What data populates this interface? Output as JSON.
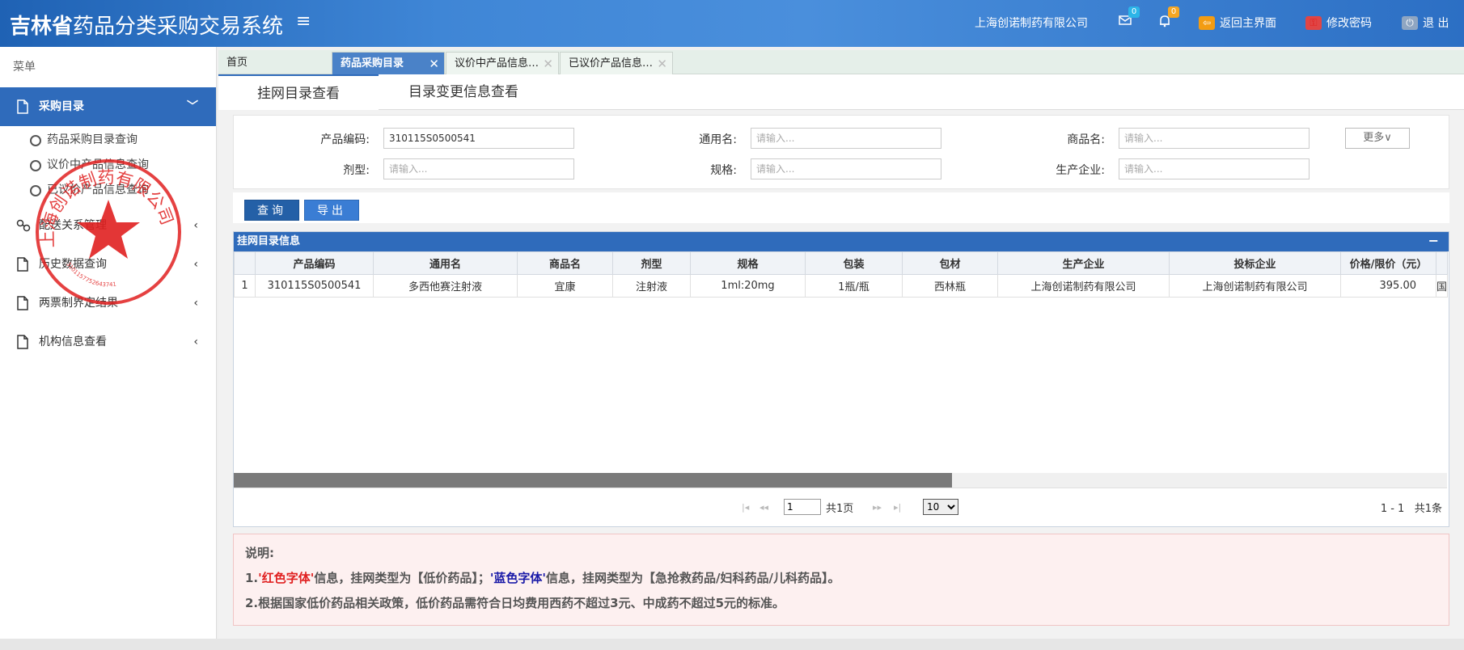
{
  "header": {
    "title_bold": "吉林省",
    "title_rest": "药品分类采购交易系统",
    "company": "上海创诺制药有限公司",
    "mail_count": "0",
    "notice_count": "0",
    "return_label": "返回主界面",
    "password_label": "修改密码",
    "logout_label": "退 出"
  },
  "sidebar": {
    "title": "菜单",
    "active_item": "采购目录",
    "sub_items": [
      "药品采购目录查询",
      "议价中产品信息查询",
      "已议价产品信息查询"
    ],
    "items": [
      "配送关系管理",
      "历史数据查询",
      "两票制界定结果",
      "机构信息查看"
    ]
  },
  "tabs": [
    "首页",
    "药品采购目录",
    "议价中产品信息…",
    "已议价产品信息…"
  ],
  "subtabs": [
    "挂网目录查看",
    "目录变更信息查看"
  ],
  "search": {
    "code_label": "产品编码:",
    "code_value": "310115S0500541",
    "generic_label": "通用名:",
    "trade_label": "商品名:",
    "form_label": "剂型:",
    "spec_label": "规格:",
    "maker_label": "生产企业:",
    "placeholder": "请输入...",
    "more_label": "更多∨"
  },
  "actions": {
    "query": "查询",
    "export": "导出"
  },
  "grid": {
    "title": "挂网目录信息",
    "collapse": "−",
    "columns": [
      "",
      "产品编码",
      "通用名",
      "商品名",
      "剂型",
      "规格",
      "包装",
      "包材",
      "生产企业",
      "投标企业",
      "价格/限价（元）",
      ""
    ],
    "rows": [
      [
        "1",
        "310115S0500541",
        "多西他赛注射液",
        "宜康",
        "注射液",
        "1ml:20mg",
        "1瓶/瓶",
        "西林瓶",
        "上海创诺制药有限公司",
        "上海创诺制药有限公司",
        "395.00",
        "国"
      ]
    ]
  },
  "pager": {
    "page_value": "1",
    "total_pages": "共1页",
    "page_size": "10",
    "summary": "1 - 1   共1条"
  },
  "note": {
    "title": "说明:",
    "line1_prefix": "1.",
    "line1_red": "'红色字体'",
    "line1_mid": "信息，挂网类型为【低价药品】；",
    "line1_blue": "'蓝色字体'",
    "line1_end": "信息，挂网类型为【急抢救药品/妇科药品/儿科药品】。",
    "line2": "2.根据国家低价药品相关政策，低价药品需符合日均费用西药不超过3元、中成药不超过5元的标准。"
  },
  "stamp": {
    "text": "上海创诺制药有限公司",
    "number": "3101157752643741"
  },
  "colors": {
    "header_blue": "#2f6bbb",
    "stamp_red": "#e02020",
    "note_red": "#e02020",
    "note_blue": "#1a1aa8"
  }
}
